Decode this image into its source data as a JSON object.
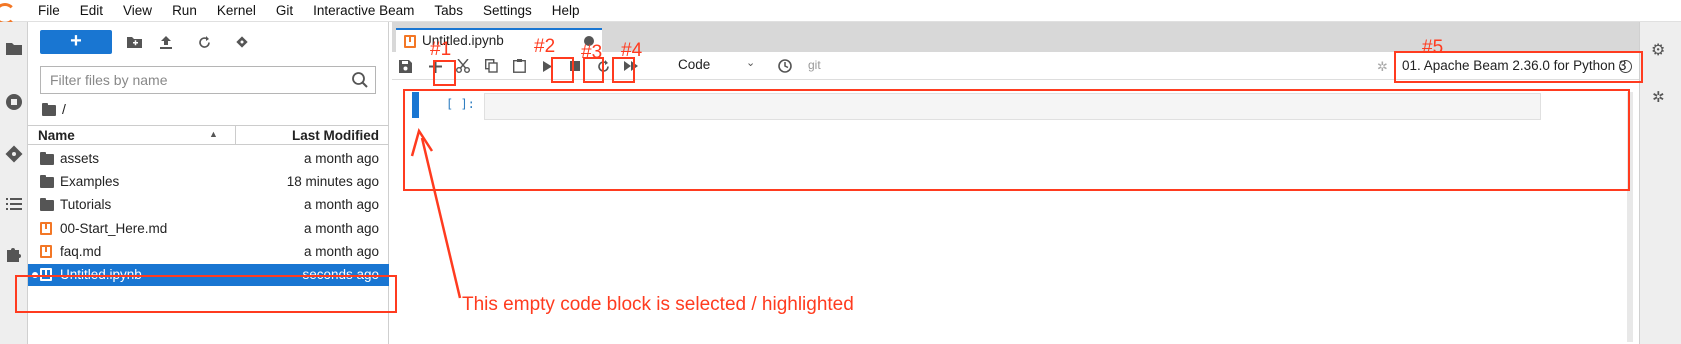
{
  "menu": [
    "File",
    "Edit",
    "View",
    "Run",
    "Kernel",
    "Git",
    "Interactive Beam",
    "Tabs",
    "Settings",
    "Help"
  ],
  "file_browser": {
    "new_label": "+",
    "filter_placeholder": "Filter files by name",
    "breadcrumb": "/",
    "col_name": "Name",
    "col_modified": "Last Modified",
    "files": [
      {
        "name": "assets",
        "modified": "a month ago",
        "icon": "folder-icon"
      },
      {
        "name": "Examples",
        "modified": "18 minutes ago",
        "icon": "folder-icon"
      },
      {
        "name": "Tutorials",
        "modified": "a month ago",
        "icon": "folder-icon"
      },
      {
        "name": "00-Start_Here.md",
        "modified": "a month ago",
        "icon": "markdown-file-icon"
      },
      {
        "name": "faq.md",
        "modified": "a month ago",
        "icon": "markdown-file-icon"
      },
      {
        "name": "Untitled.ipynb",
        "modified": "seconds ago",
        "icon": "notebook-icon",
        "selected": true
      }
    ]
  },
  "notebook": {
    "tab_label": "Untitled.ipynb",
    "cell_type": "Code",
    "git_label": "git",
    "kernel_name": "01. Apache Beam 2.36.0 for Python 3",
    "cell_prompt": "[ ]:"
  },
  "annotations": {
    "marks": [
      "#1",
      "#2",
      "#3",
      "#4",
      "#5"
    ],
    "note": "This empty code block is selected / highlighted",
    "color": "#ff3b1f"
  },
  "colors": {
    "accent": "#1976d2",
    "notebook_orange": "#f37726"
  }
}
